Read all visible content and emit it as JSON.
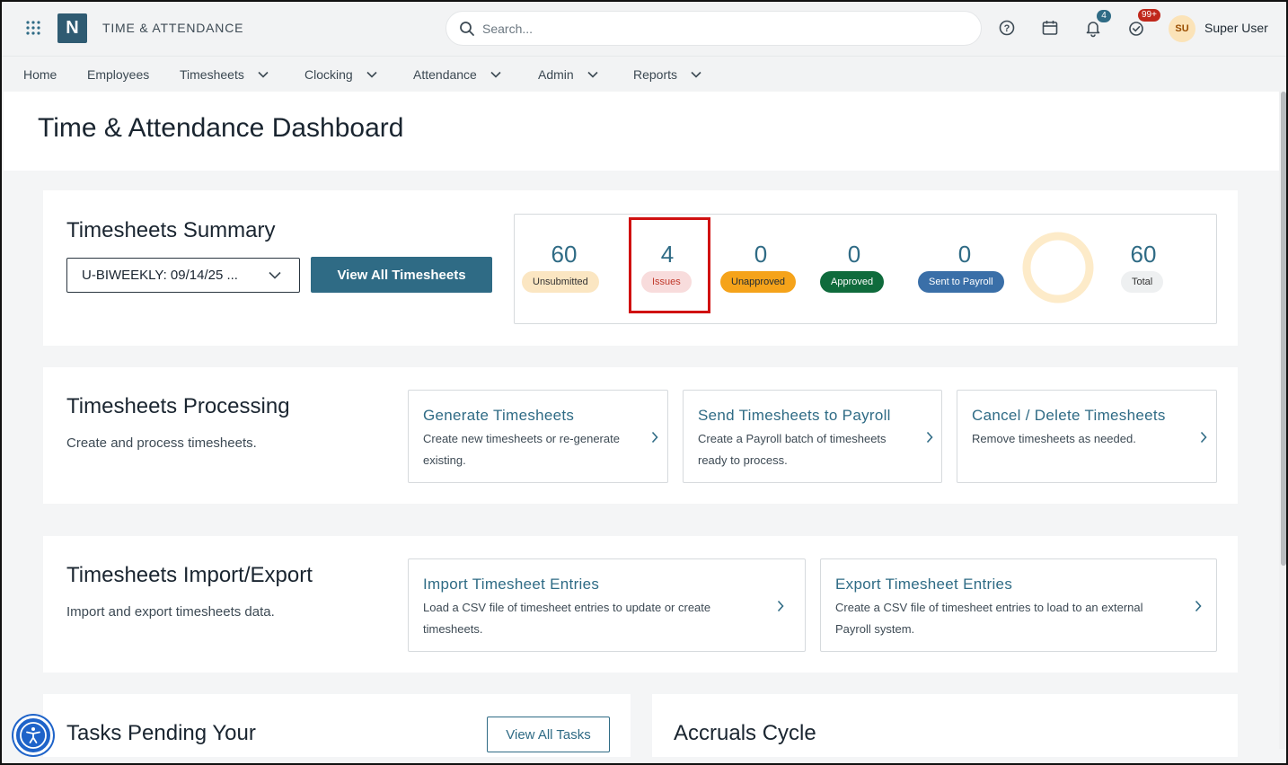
{
  "header": {
    "logo_letter": "N",
    "app_title": "TIME & ATTENDANCE",
    "search_placeholder": "Search...",
    "notifications_count": "4",
    "tasks_count": "99+",
    "avatar_initials": "SU",
    "user_name": "Super User"
  },
  "nav": {
    "items": [
      {
        "label": "Home",
        "dropdown": false
      },
      {
        "label": "Employees",
        "dropdown": false
      },
      {
        "label": "Timesheets",
        "dropdown": true
      },
      {
        "label": "Clocking",
        "dropdown": true
      },
      {
        "label": "Attendance",
        "dropdown": true
      },
      {
        "label": "Admin",
        "dropdown": true
      },
      {
        "label": "Reports",
        "dropdown": true
      }
    ]
  },
  "page": {
    "title": "Time & Attendance Dashboard"
  },
  "summary": {
    "title": "Timesheets Summary",
    "period_select": "U-BIWEEKLY: 09/14/25 ...",
    "view_all_label": "View All Timesheets",
    "stats": [
      {
        "value": "60",
        "label": "Unsubmitted",
        "bg": "#fbe6c2",
        "fg": "#333333"
      },
      {
        "value": "4",
        "label": "Issues",
        "bg": "#f8dcdc",
        "fg": "#c0392b"
      },
      {
        "value": "0",
        "label": "Unapproved",
        "bg": "#f5a31a",
        "fg": "#1f2a33"
      },
      {
        "value": "0",
        "label": "Approved",
        "bg": "#0f6b3c",
        "fg": "#ffffff"
      },
      {
        "value": "0",
        "label": "Sent to Payroll",
        "bg": "#3a6fa8",
        "fg": "#ffffff"
      },
      {
        "value": "60",
        "label": "Total",
        "bg": "#eef0f1",
        "fg": "#333333"
      }
    ]
  },
  "processing": {
    "title": "Timesheets Processing",
    "description": "Create and process timesheets.",
    "cards": [
      {
        "title": "Generate Timesheets",
        "line1": "Create new timesheets or re-generate",
        "line2": "existing."
      },
      {
        "title": "Send Timesheets to Payroll",
        "line1": "Create a Payroll batch of timesheets",
        "line2": "ready to process."
      },
      {
        "title": "Cancel / Delete Timesheets",
        "line1": "Remove timesheets as needed.",
        "line2": ""
      }
    ]
  },
  "import_export": {
    "title": "Timesheets Import/Export",
    "description": "Import and export timesheets data.",
    "cards": [
      {
        "title": "Import Timesheet Entries",
        "line1": "Load a CSV file of timesheet entries to update or create",
        "line2": "timesheets."
      },
      {
        "title": "Export Timesheet Entries",
        "line1": "Create a CSV file of timesheet entries to load to an external",
        "line2": "Payroll system."
      }
    ]
  },
  "tasks": {
    "title": "Tasks Pending Your",
    "view_all_label": "View All Tasks"
  },
  "accruals": {
    "title": "Accruals Cycle"
  },
  "colors": {
    "brand": "#2f5b72",
    "accent": "#2f6b85",
    "highlight": "#d01111"
  }
}
